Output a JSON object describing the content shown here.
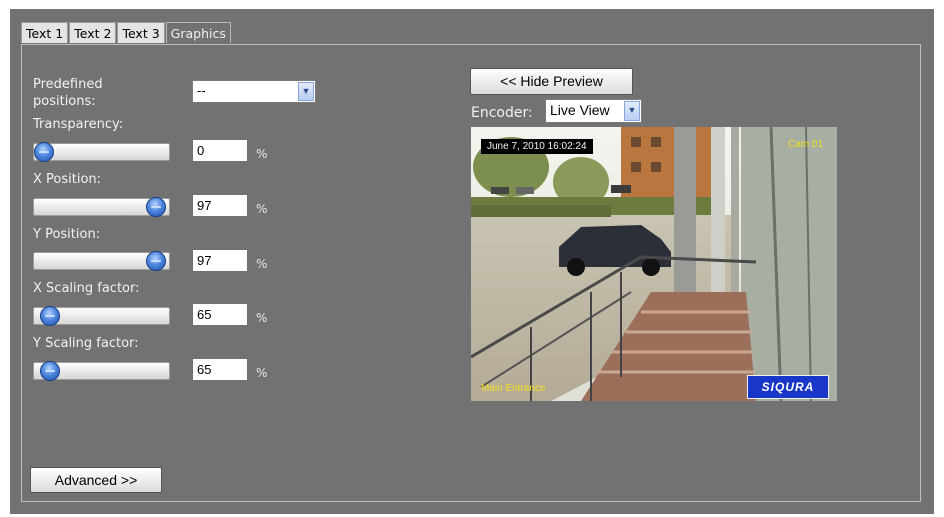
{
  "tabs": [
    {
      "label": "Text 1",
      "active": false
    },
    {
      "label": "Text 2",
      "active": false
    },
    {
      "label": "Text 3",
      "active": false
    },
    {
      "label": "Graphics",
      "active": true
    }
  ],
  "form": {
    "predefined_label_line1": "Predefined",
    "predefined_label_line2": "positions:",
    "predefined_value": "--",
    "transparency": {
      "label": "Transparency:",
      "value": "0",
      "unit": "%",
      "slider_fraction": 0.0
    },
    "x_position": {
      "label": "X Position:",
      "value": "97",
      "unit": "%",
      "slider_fraction": 0.97
    },
    "y_position": {
      "label": "Y Position:",
      "value": "97",
      "unit": "%",
      "slider_fraction": 0.97
    },
    "x_scaling": {
      "label": "X Scaling factor:",
      "value": "65",
      "unit": "%",
      "slider_fraction": 0.05
    },
    "y_scaling": {
      "label": "Y Scaling factor:",
      "value": "65",
      "unit": "%",
      "slider_fraction": 0.05
    }
  },
  "buttons": {
    "advanced": "Advanced >>",
    "hide_preview": "<< Hide Preview"
  },
  "preview": {
    "encoder_label": "Encoder:",
    "encoder_value": "Live View",
    "timestamp": "June 7, 2010 16:02:24",
    "camera_name": "Cam 01",
    "location": "Main Entrance",
    "logo": "SIQURA"
  },
  "colors": {
    "panel_bg": "#727272",
    "slider_thumb": "#3f78d4",
    "overlay_text": "#f0e020",
    "logo_bg": "#1836c8"
  }
}
